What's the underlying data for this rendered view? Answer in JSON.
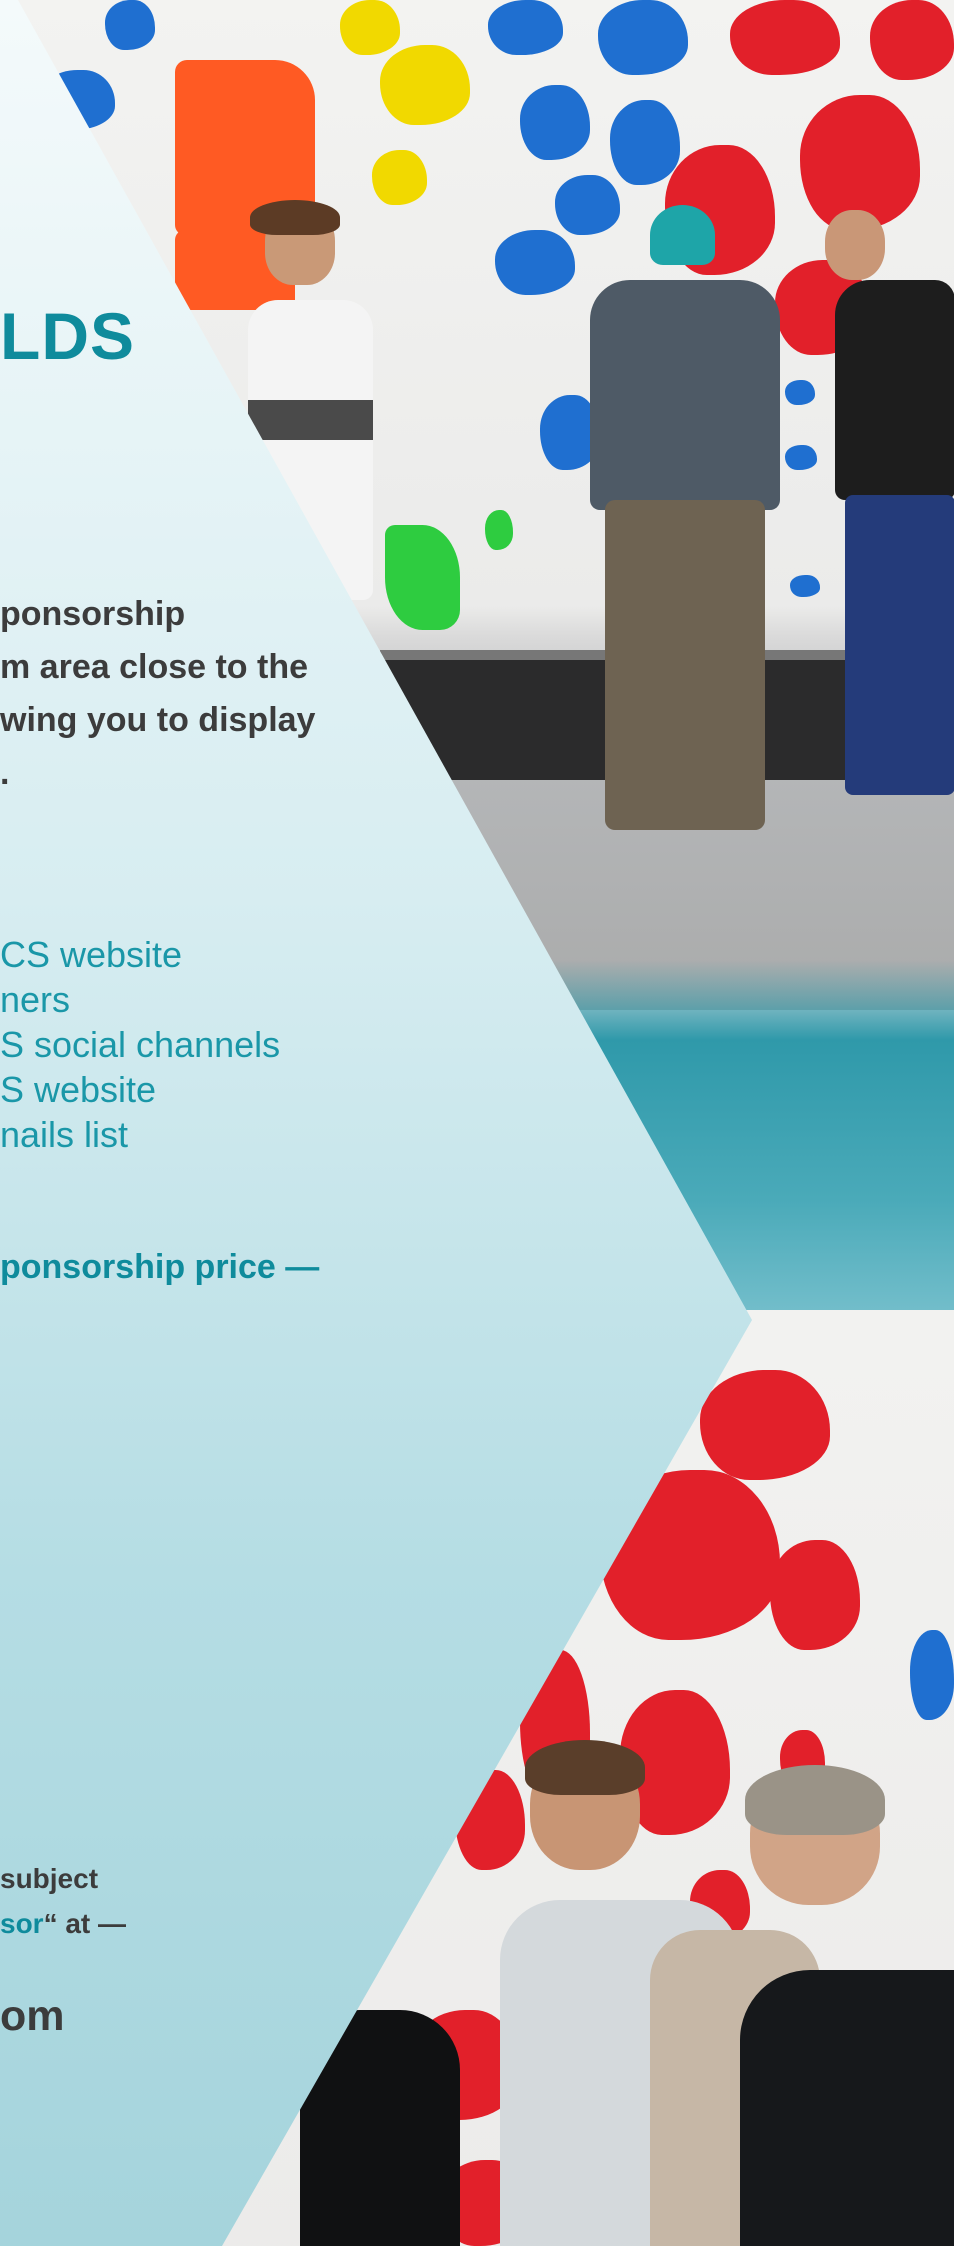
{
  "heading": "LDS",
  "body_lines": [
    "ponsorship",
    "m area close to the",
    "wing you to display",
    "."
  ],
  "benefits": [
    "CS website",
    "ners",
    "S social channels",
    "S website",
    "nails list"
  ],
  "price_text": "ponsorship price —",
  "contact": {
    "line1": "subject",
    "line2_accent": "sor",
    "line2_rest": "“ at —"
  },
  "email_text": "om",
  "colors": {
    "teal": "#0f8b9c",
    "text_dark": "#3c3c3c"
  }
}
